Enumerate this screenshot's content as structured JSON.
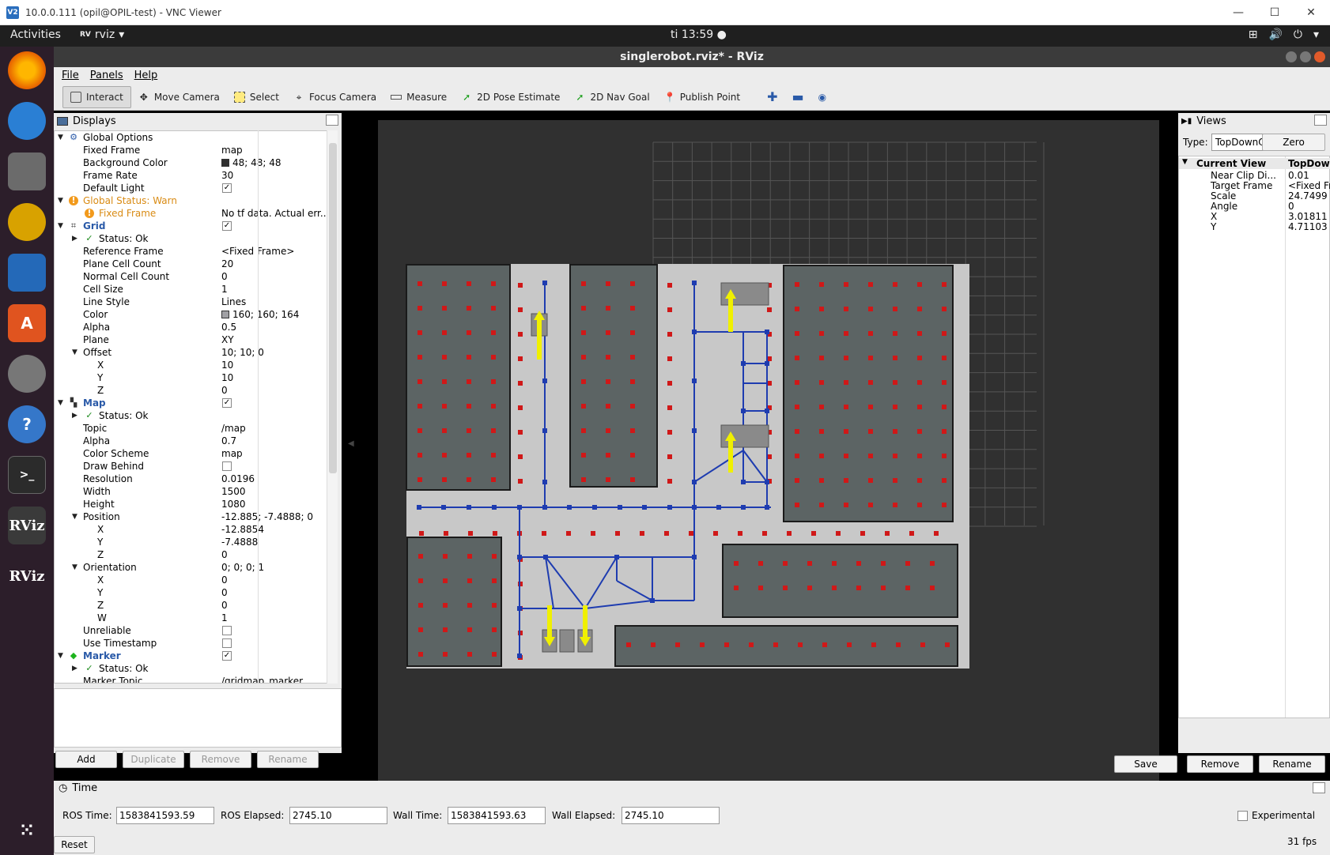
{
  "vnc": {
    "title": "10.0.0.111 (opil@OPIL-test) - VNC Viewer",
    "logo": "V2",
    "min": "—",
    "max": "☐",
    "close": "✕"
  },
  "gnome": {
    "activities": "Activities",
    "app": "rviz",
    "app_icon": "RV",
    "clock": "ti 13:59"
  },
  "dock": {
    "items": [
      "firefox-icon",
      "thunderbird-icon",
      "files-icon",
      "rhythmbox-icon",
      "writer-icon",
      "software-icon",
      "settings-icon",
      "help-icon",
      "terminal-icon",
      "rviz-icon",
      "rviz-icon"
    ],
    "rviz_label": "RViz",
    "help_label": "?",
    "terminal_label": ">_",
    "software_label": "A"
  },
  "window": {
    "title": "singlerobot.rviz* - RViz"
  },
  "menu": {
    "file": "File",
    "panels": "Panels",
    "help": "Help"
  },
  "toolbar": {
    "interact": "Interact",
    "move_camera": "Move Camera",
    "select": "Select",
    "focus_camera": "Focus Camera",
    "measure": "Measure",
    "pose_estimate": "2D Pose Estimate",
    "nav_goal": "2D Nav Goal",
    "publish_point": "Publish Point"
  },
  "displays": {
    "title": "Displays",
    "rows": [
      {
        "label": "Global Options",
        "value": "",
        "indent": 0,
        "arrow": "▼",
        "style": "",
        "icon": "gear"
      },
      {
        "label": "Fixed Frame",
        "value": "map",
        "indent": 2
      },
      {
        "label": "Background Color",
        "value": "48; 48; 48",
        "indent": 2,
        "swatch": "#303030"
      },
      {
        "label": "Frame Rate",
        "value": "30",
        "indent": 2
      },
      {
        "label": "Default Light",
        "value": "",
        "indent": 2,
        "check": "✓"
      },
      {
        "label": "Global Status: Warn",
        "value": "",
        "indent": 0,
        "arrow": "▼",
        "style": "orange",
        "icon": "warn"
      },
      {
        "label": "Fixed Frame",
        "value": "No tf data.  Actual err...",
        "indent": 1,
        "style": "orange",
        "icon": "warn"
      },
      {
        "label": "Grid",
        "value": "",
        "indent": 0,
        "arrow": "▼",
        "style": "blue",
        "icon": "grid",
        "check": "✓"
      },
      {
        "label": "Status: Ok",
        "value": "",
        "indent": 1,
        "arrow": "▶",
        "icon": "ok"
      },
      {
        "label": "Reference Frame",
        "value": "<Fixed Frame>",
        "indent": 2
      },
      {
        "label": "Plane Cell Count",
        "value": "20",
        "indent": 2
      },
      {
        "label": "Normal Cell Count",
        "value": "0",
        "indent": 2
      },
      {
        "label": "Cell Size",
        "value": "1",
        "indent": 2
      },
      {
        "label": "Line Style",
        "value": "Lines",
        "indent": 2
      },
      {
        "label": "Color",
        "value": "160; 160; 164",
        "indent": 2,
        "swatch": "#a0a0a4"
      },
      {
        "label": "Alpha",
        "value": "0.5",
        "indent": 2
      },
      {
        "label": "Plane",
        "value": "XY",
        "indent": 2
      },
      {
        "label": "Offset",
        "value": "10; 10; 0",
        "indent": 2,
        "arrow": "▼"
      },
      {
        "label": "X",
        "value": "10",
        "indent": 3
      },
      {
        "label": "Y",
        "value": "10",
        "indent": 3
      },
      {
        "label": "Z",
        "value": "0",
        "indent": 3
      },
      {
        "label": "Map",
        "value": "",
        "indent": 0,
        "arrow": "▼",
        "style": "blue",
        "icon": "map",
        "check": "✓"
      },
      {
        "label": "Status: Ok",
        "value": "",
        "indent": 1,
        "arrow": "▶",
        "icon": "ok"
      },
      {
        "label": "Topic",
        "value": "/map",
        "indent": 2
      },
      {
        "label": "Alpha",
        "value": "0.7",
        "indent": 2
      },
      {
        "label": "Color Scheme",
        "value": "map",
        "indent": 2
      },
      {
        "label": "Draw Behind",
        "value": "",
        "indent": 2,
        "check": " "
      },
      {
        "label": "Resolution",
        "value": "0.0196",
        "indent": 2
      },
      {
        "label": "Width",
        "value": "1500",
        "indent": 2
      },
      {
        "label": "Height",
        "value": "1080",
        "indent": 2
      },
      {
        "label": "Position",
        "value": "-12.885; -7.4888; 0",
        "indent": 2,
        "arrow": "▼"
      },
      {
        "label": "X",
        "value": "-12.8854",
        "indent": 3
      },
      {
        "label": "Y",
        "value": "-7.4888",
        "indent": 3
      },
      {
        "label": "Z",
        "value": "0",
        "indent": 3
      },
      {
        "label": "Orientation",
        "value": "0; 0; 0; 1",
        "indent": 2,
        "arrow": "▼"
      },
      {
        "label": "X",
        "value": "0",
        "indent": 3
      },
      {
        "label": "Y",
        "value": "0",
        "indent": 3
      },
      {
        "label": "Z",
        "value": "0",
        "indent": 3
      },
      {
        "label": "W",
        "value": "1",
        "indent": 3
      },
      {
        "label": "Unreliable",
        "value": "",
        "indent": 2,
        "check": " "
      },
      {
        "label": "Use Timestamp",
        "value": "",
        "indent": 2,
        "check": " "
      },
      {
        "label": "Marker",
        "value": "",
        "indent": 0,
        "arrow": "▼",
        "style": "blue",
        "icon": "marker",
        "check": "✓"
      },
      {
        "label": "Status: Ok",
        "value": "",
        "indent": 1,
        "arrow": "▶",
        "icon": "ok"
      },
      {
        "label": "Marker Topic",
        "value": "/gridmap_marker",
        "indent": 2
      }
    ],
    "buttons": {
      "add": "Add",
      "duplicate": "Duplicate",
      "remove": "Remove",
      "rename": "Rename"
    }
  },
  "views": {
    "title": "Views",
    "type_label": "Type:",
    "type_value": "TopDownOrtho (rvi",
    "zero": "Zero",
    "header": {
      "k": "Current View",
      "v": "TopDownOrtho (r..."
    },
    "rows": [
      {
        "k": "Near Clip Di...",
        "v": "0.01"
      },
      {
        "k": "Target Frame",
        "v": "<Fixed Frame>"
      },
      {
        "k": "Scale",
        "v": "24.7499"
      },
      {
        "k": "Angle",
        "v": "0"
      },
      {
        "k": "X",
        "v": "3.01811"
      },
      {
        "k": "Y",
        "v": "4.71103"
      }
    ],
    "buttons": {
      "save": "Save",
      "remove": "Remove",
      "rename": "Rename"
    }
  },
  "time": {
    "title": "Time",
    "ros_time_label": "ROS Time:",
    "ros_time": "1583841593.59",
    "ros_elapsed_label": "ROS Elapsed:",
    "ros_elapsed": "2745.10",
    "wall_time_label": "Wall Time:",
    "wall_time": "1583841593.63",
    "wall_elapsed_label": "Wall Elapsed:",
    "wall_elapsed": "2745.10",
    "experimental": "Experimental",
    "reset": "Reset",
    "fps": "31 fps"
  },
  "colors": {
    "viewport_bg": "#303030",
    "map_free": "#c8c8c8",
    "map_occupied": "#5c6464",
    "path": "#1e3cb0",
    "marker_red": "#d01818",
    "arrow_yellow": "#f0f000"
  }
}
